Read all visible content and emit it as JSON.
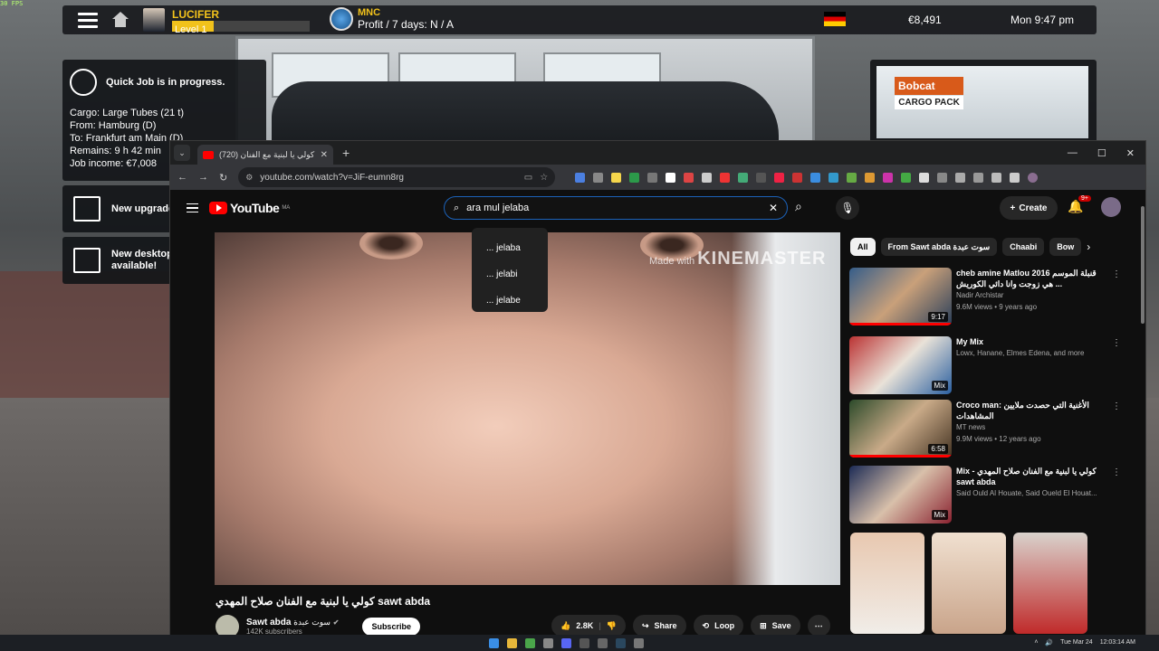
{
  "fps": "30 FPS",
  "hud": {
    "user_name": "LUCIFER",
    "level": "Level 1",
    "level_progress": 0.3,
    "company_name": "MNC",
    "profit": "Profit / 7 days: N / A",
    "money": "€8,491",
    "datetime": "Mon 9:47 pm"
  },
  "quick_job": {
    "title": "Quick Job is in progress.",
    "cargo_label": "Cargo:",
    "cargo": "Large Tubes (21 t)",
    "from_label": "From:",
    "from": "Hamburg (D)",
    "to_label": "To:",
    "to": "Frankfurt am Main (D)",
    "remains_label": "Remains:",
    "remains": "9 h 42 min",
    "income_label": "Job income:",
    "income": "€7,008"
  },
  "notices": {
    "upgrade": "New upgrade",
    "desktop_line1": "New desktop",
    "desktop_line2": "available!"
  },
  "ad": {
    "brand": "Bobcat",
    "tagline": "CARGO PACK"
  },
  "browser": {
    "tab_title": "(720) كولي يا لبنية مع الفنان",
    "url": "youtube.com/watch?v=JiF-eumn8rg"
  },
  "youtube": {
    "logo": "YouTube",
    "region": "MA",
    "search_query": "ara mul jelaba",
    "suggestions": [
      "... jelaba",
      "... jelabi",
      "... jelabe"
    ],
    "create": "Create",
    "notif_count": "9+",
    "watermark_prefix": "Made with",
    "watermark_brand": "KINEMASTER",
    "video_title": "كولي يا لبنية مع الفنان صلاح المهدي sawt abda",
    "channel_name": "Sawt abda",
    "channel_name_ar": "سوت عبدة",
    "subscribers": "142K subscribers",
    "subscribe": "Subscribe",
    "likes": "2.8K",
    "share": "Share",
    "loop": "Loop",
    "save": "Save",
    "chips": [
      "All",
      "From Sawt abda سوت عبدة",
      "Chaabi",
      "Bow"
    ],
    "recommendations": [
      {
        "title": "cheb amine Matlou 2016 قنبلة الموسم هي زوجت وانا دائي الكوريش ...",
        "channel": "Nadir Archistar",
        "meta": "9.6M views • 9 years ago",
        "duration": "9:17"
      },
      {
        "title": "My Mix",
        "channel": "Lowx, Hanane, Elmes Edena, and more",
        "meta": "",
        "duration": "Mix"
      },
      {
        "title": "Croco man: الأغنية التي حصدت ملايين المشاهدات",
        "channel": "MT news",
        "meta": "9.9M views • 12 years ago",
        "duration": "6:58"
      },
      {
        "title": "Mix - كولي يا لبنية مع الفنان صلاح المهدي sawt abda",
        "channel": "Said Ould Al Houate, Said Oueld El Houat...",
        "meta": "",
        "duration": "Mix"
      }
    ]
  },
  "taskbar": {
    "date": "Tue Mar 24",
    "time": "12:03:14 AM"
  }
}
